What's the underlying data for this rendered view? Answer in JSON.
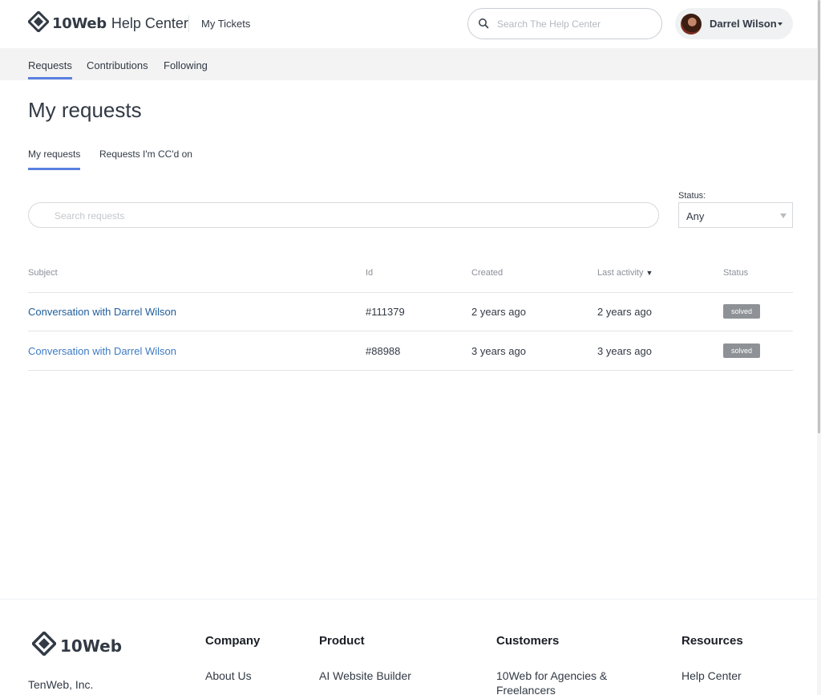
{
  "header": {
    "brand": "10Web",
    "brand_suffix": "Help Center",
    "my_tickets": "My Tickets",
    "search_placeholder": "Search The Help Center",
    "user_name": "Darrel Wilson"
  },
  "subnav": {
    "items": [
      {
        "label": "Requests"
      },
      {
        "label": "Contributions"
      },
      {
        "label": "Following"
      }
    ],
    "active": "Requests"
  },
  "main": {
    "title": "My requests",
    "tabs": [
      {
        "label": "My requests"
      },
      {
        "label": "Requests I'm CC'd on"
      }
    ],
    "search_placeholder": "Search requests",
    "status_filter": {
      "label": "Status:",
      "value": "Any"
    }
  },
  "table": {
    "headers": {
      "subject": "Subject",
      "id": "Id",
      "created": "Created",
      "last_activity": "Last activity",
      "status": "Status"
    },
    "rows": [
      {
        "subject": "Conversation with Darrel Wilson",
        "id": "#111379",
        "created": "2 years ago",
        "last_activity": "2 years ago",
        "status": "solved"
      },
      {
        "subject": "Conversation with Darrel Wilson",
        "id": "#88988",
        "created": "3 years ago",
        "last_activity": "3 years ago",
        "status": "solved"
      }
    ]
  },
  "footer": {
    "brand": "10Web",
    "company_name": "TenWeb, Inc.",
    "columns": [
      {
        "heading": "Company",
        "link": "About Us"
      },
      {
        "heading": "Product",
        "link": "AI Website Builder"
      },
      {
        "heading": "Customers",
        "link": "10Web for Agencies & Freelancers"
      },
      {
        "heading": "Resources",
        "link": "Help Center"
      }
    ]
  },
  "colors": {
    "accent": "#5a7fe0",
    "link": "#1f5d9c",
    "badge": "#8e9297",
    "subnav_bg": "#f3f3f3"
  },
  "icons": [
    "10web-logo-icon",
    "search-icon",
    "avatar",
    "caret-down-icon",
    "sort-down-icon",
    "dropdown-arrow-icon"
  ]
}
